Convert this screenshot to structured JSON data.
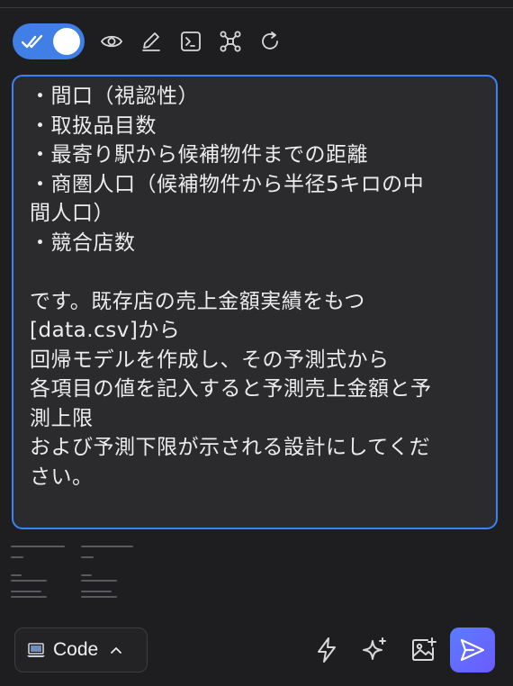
{
  "toolbar": {
    "toggle_state": "on",
    "accent_color": "#3f7fe6",
    "icons": [
      "double-check-icon",
      "eye-icon",
      "pencil-icon",
      "terminal-icon",
      "nodes-icon",
      "refresh-icon"
    ]
  },
  "editor": {
    "lines": [
      "・間口（視認性）",
      "・取扱品目数",
      "・最寄り駅から候補物件までの距離",
      "・商圏人口（候補物件から半径5キロの中",
      "間人口）",
      "・競合店数",
      "",
      "です。既存店の売上金額実績をもつ",
      "[data.csv]から",
      "回帰モデルを作成し、その予測式から",
      "各項目の値を記入すると予測売上金額と予",
      "測上限",
      "および予測下限が示される設計にしてくだ",
      "さい。"
    ],
    "border_color": "#3b82f6"
  },
  "bottom": {
    "mode_label": "Code",
    "mode_icon": "laptop-icon",
    "actions": [
      "lightning-icon",
      "sparkle-icon",
      "add-image-icon"
    ],
    "send_icon": "send-icon",
    "send_color": "#5b6bff"
  }
}
